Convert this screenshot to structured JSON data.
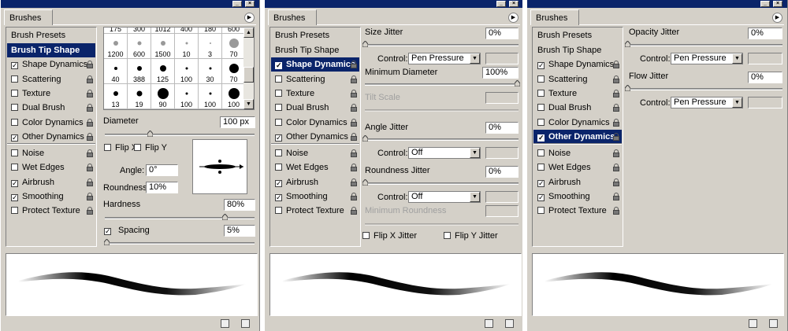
{
  "panels": [
    {
      "tab": "Brushes",
      "list_head": "Brush Presets",
      "items": [
        {
          "label": "Brush Tip Shape",
          "checkbox": false,
          "checked": false,
          "selected": true,
          "lock": false
        },
        {
          "label": "Shape Dynamics",
          "checkbox": true,
          "checked": true,
          "selected": false,
          "lock": true
        },
        {
          "label": "Scattering",
          "checkbox": true,
          "checked": false,
          "selected": false,
          "lock": true
        },
        {
          "label": "Texture",
          "checkbox": true,
          "checked": false,
          "selected": false,
          "lock": true
        },
        {
          "label": "Dual Brush",
          "checkbox": true,
          "checked": false,
          "selected": false,
          "lock": true
        },
        {
          "label": "Color Dynamics",
          "checkbox": true,
          "checked": false,
          "selected": false,
          "lock": true
        },
        {
          "label": "Other Dynamics",
          "checkbox": true,
          "checked": true,
          "selected": false,
          "lock": true
        },
        {
          "label": "Noise",
          "checkbox": true,
          "checked": false,
          "selected": false,
          "lock": true
        },
        {
          "label": "Wet Edges",
          "checkbox": true,
          "checked": false,
          "selected": false,
          "lock": true
        },
        {
          "label": "Airbrush",
          "checkbox": true,
          "checked": true,
          "selected": false,
          "lock": true
        },
        {
          "label": "Smoothing",
          "checkbox": true,
          "checked": true,
          "selected": false,
          "lock": true
        },
        {
          "label": "Protect Texture",
          "checkbox": true,
          "checked": false,
          "selected": false,
          "lock": true
        }
      ]
    },
    {
      "tab": "Brushes",
      "list_head": "Brush Presets",
      "items": [
        {
          "label": "Brush Tip Shape",
          "checkbox": false,
          "checked": false,
          "selected": false,
          "lock": false
        },
        {
          "label": "Shape Dynamics",
          "checkbox": true,
          "checked": true,
          "selected": true,
          "lock": true
        },
        {
          "label": "Scattering",
          "checkbox": true,
          "checked": false,
          "selected": false,
          "lock": true
        },
        {
          "label": "Texture",
          "checkbox": true,
          "checked": false,
          "selected": false,
          "lock": true
        },
        {
          "label": "Dual Brush",
          "checkbox": true,
          "checked": false,
          "selected": false,
          "lock": true
        },
        {
          "label": "Color Dynamics",
          "checkbox": true,
          "checked": false,
          "selected": false,
          "lock": true
        },
        {
          "label": "Other Dynamics",
          "checkbox": true,
          "checked": true,
          "selected": false,
          "lock": true
        },
        {
          "label": "Noise",
          "checkbox": true,
          "checked": false,
          "selected": false,
          "lock": true
        },
        {
          "label": "Wet Edges",
          "checkbox": true,
          "checked": false,
          "selected": false,
          "lock": true
        },
        {
          "label": "Airbrush",
          "checkbox": true,
          "checked": true,
          "selected": false,
          "lock": true
        },
        {
          "label": "Smoothing",
          "checkbox": true,
          "checked": true,
          "selected": false,
          "lock": true
        },
        {
          "label": "Protect Texture",
          "checkbox": true,
          "checked": false,
          "selected": false,
          "lock": true
        }
      ]
    },
    {
      "tab": "Brushes",
      "list_head": "Brush Presets",
      "items": [
        {
          "label": "Brush Tip Shape",
          "checkbox": false,
          "checked": false,
          "selected": false,
          "lock": false
        },
        {
          "label": "Shape Dynamics",
          "checkbox": true,
          "checked": true,
          "selected": false,
          "lock": true
        },
        {
          "label": "Scattering",
          "checkbox": true,
          "checked": false,
          "selected": false,
          "lock": true
        },
        {
          "label": "Texture",
          "checkbox": true,
          "checked": false,
          "selected": false,
          "lock": true
        },
        {
          "label": "Dual Brush",
          "checkbox": true,
          "checked": false,
          "selected": false,
          "lock": true
        },
        {
          "label": "Color Dynamics",
          "checkbox": true,
          "checked": false,
          "selected": false,
          "lock": true
        },
        {
          "label": "Other Dynamics",
          "checkbox": true,
          "checked": true,
          "selected": true,
          "lock": true
        },
        {
          "label": "Noise",
          "checkbox": true,
          "checked": false,
          "selected": false,
          "lock": true
        },
        {
          "label": "Wet Edges",
          "checkbox": true,
          "checked": false,
          "selected": false,
          "lock": true
        },
        {
          "label": "Airbrush",
          "checkbox": true,
          "checked": true,
          "selected": false,
          "lock": true
        },
        {
          "label": "Smoothing",
          "checkbox": true,
          "checked": true,
          "selected": false,
          "lock": true
        },
        {
          "label": "Protect Texture",
          "checkbox": true,
          "checked": false,
          "selected": false,
          "lock": true
        }
      ]
    }
  ],
  "tip_shape": {
    "grid_rows": [
      [
        "175",
        "300",
        "1012",
        "400",
        "180",
        "600"
      ],
      [
        "1200",
        "600",
        "1500",
        "10",
        "3",
        "70"
      ],
      [
        "40",
        "388",
        "125",
        "100",
        "30",
        "70"
      ],
      [
        "13",
        "19",
        "90",
        "100",
        "100",
        "100"
      ]
    ],
    "diameter_label": "Diameter",
    "diameter_value": "100 px",
    "diameter_level": 0.3,
    "flipx_label": "Flip X",
    "flipy_label": "Flip Y",
    "angle_label": "Angle:",
    "angle_value": "0°",
    "roundness_label": "Roundness:",
    "roundness_value": "10%",
    "hardness_label": "Hardness",
    "hardness_value": "80%",
    "hardness_level": 0.8,
    "spacing_label": "Spacing",
    "spacing_value": "5%",
    "spacing_checked": true,
    "spacing_level": 0.01
  },
  "shape_dynamics": {
    "size_jitter_label": "Size Jitter",
    "size_jitter_value": "0%",
    "control_label": "Control:",
    "control1_value": "Pen Pressure",
    "min_diameter_label": "Minimum Diameter",
    "min_diameter_value": "100%",
    "tilt_scale_label": "Tilt Scale",
    "angle_jitter_label": "Angle Jitter",
    "angle_jitter_value": "0%",
    "control2_value": "Off",
    "roundness_jitter_label": "Roundness Jitter",
    "roundness_jitter_value": "0%",
    "control3_value": "Off",
    "min_roundness_label": "Minimum Roundness",
    "flipx_jitter_label": "Flip X Jitter",
    "flipy_jitter_label": "Flip Y Jitter"
  },
  "other_dynamics": {
    "opacity_jitter_label": "Opacity Jitter",
    "opacity_jitter_value": "0%",
    "control_label": "Control:",
    "control1_value": "Pen Pressure",
    "flow_jitter_label": "Flow Jitter",
    "flow_jitter_value": "0%",
    "control2_value": "Pen Pressure"
  }
}
